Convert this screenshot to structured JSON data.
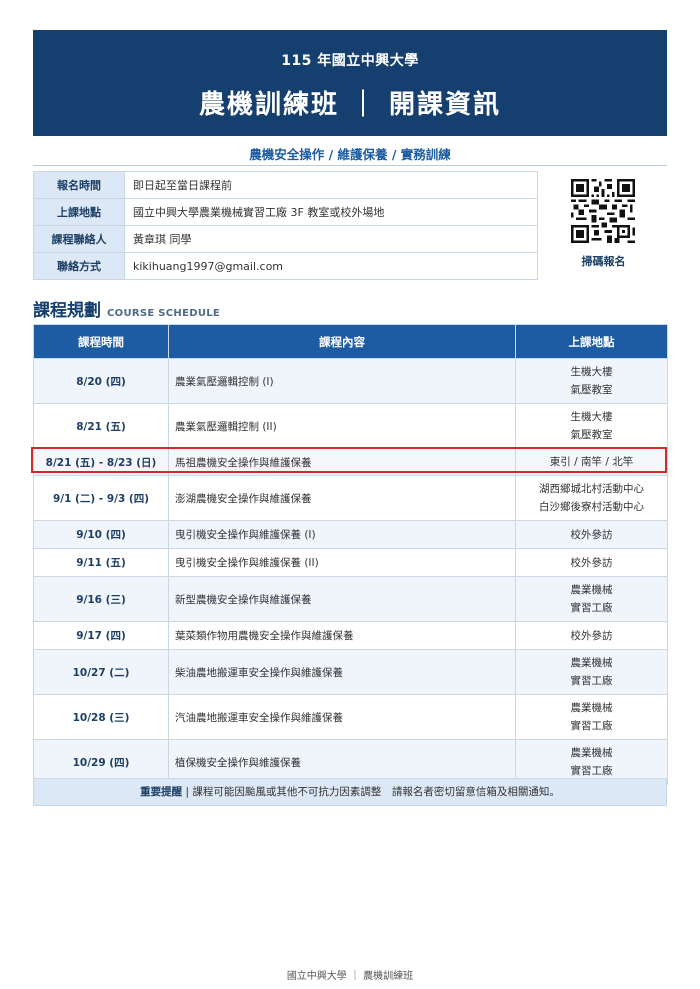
{
  "header": {
    "year": "115 年國立中興大學",
    "title": "農機訓練班 ｜ 開課資訊"
  },
  "subtitle": "農機安全操作 / 維護保養 / 實務訓練",
  "info": [
    {
      "label": "報名時間",
      "value": "即日起至當日課程前"
    },
    {
      "label": "上課地點",
      "value": "國立中興大學農業機械實習工廠 3F 教室或校外場地"
    },
    {
      "label": "課程聯絡人",
      "value": "黃章琪 同學"
    },
    {
      "label": "聯絡方式",
      "value": "kikihuang1997@gmail.com"
    }
  ],
  "qr_label": "掃碼報名",
  "section": {
    "title": "課程規劃",
    "subtitle": "COURSE SCHEDULE"
  },
  "schedule": {
    "headers": [
      "課程時間",
      "課程內容",
      "上課地點"
    ],
    "rows": [
      {
        "date": "8/20 (四)",
        "content": "農業氣壓邏輯控制 (I)",
        "place1": "生機大樓",
        "place2": "氣壓教室"
      },
      {
        "date": "8/21 (五)",
        "content": "農業氣壓邏輯控制 (II)",
        "place1": "生機大樓",
        "place2": "氣壓教室"
      },
      {
        "date": "8/21 (五) - 8/23 (日)",
        "content": "馬祖農機安全操作與維護保養",
        "place1": "東引 / 南竿 / 北竿",
        "place2": ""
      },
      {
        "date": "9/1 (二) - 9/3 (四)",
        "content": "澎湖農機安全操作與維護保養",
        "place1": "湖西鄉城北村活動中心",
        "place2": "白沙鄉後寮村活動中心"
      },
      {
        "date": "9/10 (四)",
        "content": "曳引機安全操作與維護保養 (I)",
        "place1": "校外參訪",
        "place2": ""
      },
      {
        "date": "9/11 (五)",
        "content": "曳引機安全操作與維護保養 (II)",
        "place1": "校外參訪",
        "place2": ""
      },
      {
        "date": "9/16 (三)",
        "content": "新型農機安全操作與維護保養",
        "place1": "農業機械",
        "place2": "實習工廠"
      },
      {
        "date": "9/17 (四)",
        "content": "葉菜類作物用農機安全操作與維護保養",
        "place1": "校外參訪",
        "place2": ""
      },
      {
        "date": "10/27 (二)",
        "content": "柴油農地搬運車安全操作與維護保養",
        "place1": "農業機械",
        "place2": "實習工廠"
      },
      {
        "date": "10/28 (三)",
        "content": "汽油農地搬運車安全操作與維護保養",
        "place1": "農業機械",
        "place2": "實習工廠"
      },
      {
        "date": "10/29 (四)",
        "content": "植保機安全操作與維護保養",
        "place1": "農業機械",
        "place2": "實習工廠"
      }
    ]
  },
  "note": {
    "label": "重要提醒",
    "text": "| 課程可能因颱風或其他不可抗力因素調整　請報名者密切留意信箱及相關通知。"
  },
  "footer": "國立中興大學 ｜ 農機訓練班"
}
